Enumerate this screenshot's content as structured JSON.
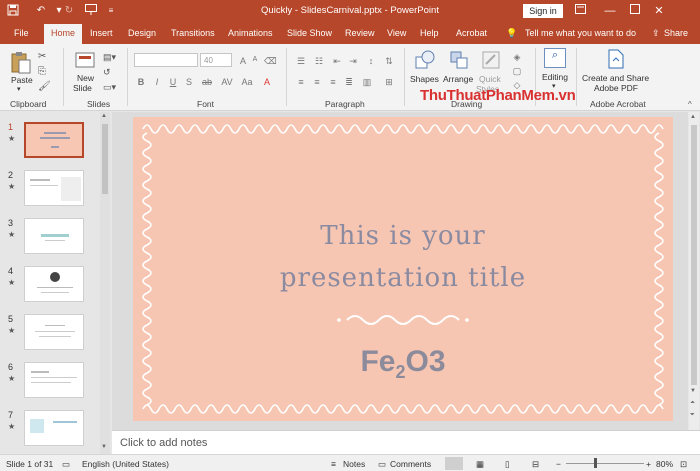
{
  "window": {
    "title": "Quickly - SlidesCarnival.pptx  -  PowerPoint",
    "signin": "Sign in",
    "quick_access": [
      "save-icon",
      "undo-icon",
      "redo-icon",
      "slideshow-icon",
      "customize-icon"
    ],
    "controls": [
      "ribbon-display-icon",
      "minimize-icon",
      "maximize-icon",
      "close-icon"
    ]
  },
  "tabs": [
    "File",
    "Home",
    "Insert",
    "Design",
    "Transitions",
    "Animations",
    "Slide Show",
    "Review",
    "View",
    "Help",
    "Acrobat"
  ],
  "active_tab": "Home",
  "tell_me": "Tell me what you want to do",
  "share": "Share",
  "ribbon": {
    "clipboard": {
      "label": "Clipboard",
      "paste": "Paste"
    },
    "slides": {
      "label": "Slides",
      "new_slide_1": "New",
      "new_slide_2": "Slide"
    },
    "font": {
      "label": "Font",
      "size_value": "40",
      "buttons": [
        "B",
        "I",
        "U",
        "S",
        "ab",
        "AV",
        "Aa",
        "A"
      ]
    },
    "paragraph": {
      "label": "Paragraph"
    },
    "drawing": {
      "label": "Drawing",
      "shapes": "Shapes",
      "arrange": "Arrange",
      "quick_1": "Quick",
      "quick_2": "Styles"
    },
    "editing": {
      "label": "Editing"
    },
    "acrobat": {
      "label": "Adobe Acrobat",
      "create_1": "Create and Share",
      "create_2": "Adobe PDF"
    }
  },
  "watermark": "ThuThuatPhanMem.vn",
  "thumbnails": [
    {
      "num": "1",
      "star": "★"
    },
    {
      "num": "2",
      "star": "★"
    },
    {
      "num": "3",
      "star": "★"
    },
    {
      "num": "4",
      "star": "★"
    },
    {
      "num": "5",
      "star": "★"
    },
    {
      "num": "6",
      "star": "★"
    },
    {
      "num": "7",
      "star": "★"
    }
  ],
  "slide": {
    "title_line1": "This is your",
    "title_line2": "presentation title",
    "formula_a": "Fe",
    "formula_sub": "2",
    "formula_b": "O3",
    "bg_color": "#f7c6b2",
    "text_color": "#8a8aa0"
  },
  "notes_placeholder": "Click to add notes",
  "status": {
    "slide_info": "Slide 1 of 31",
    "language": "English (United States)",
    "notes": "Notes",
    "comments": "Comments",
    "zoom": "80%"
  },
  "accent": "#b7472a"
}
